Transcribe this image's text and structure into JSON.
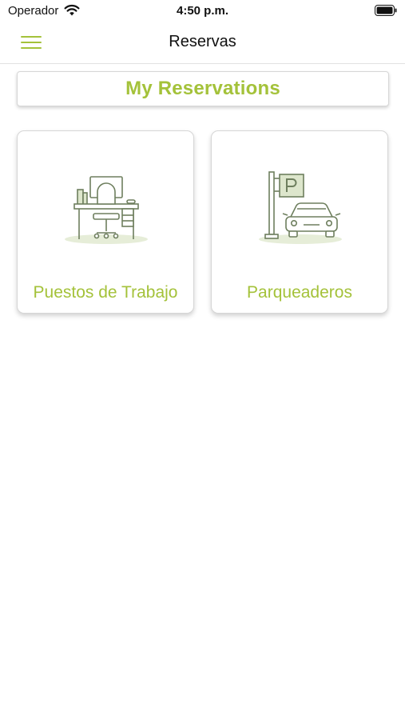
{
  "status_bar": {
    "carrier": "Operador",
    "time": "4:50 p.m."
  },
  "nav": {
    "title": "Reservas",
    "menu_icon": "hamburger-menu-icon"
  },
  "my_reservations": {
    "label": "My Reservations"
  },
  "cards": [
    {
      "label": "Puestos de Trabajo",
      "icon": "workstation-desk-icon"
    },
    {
      "label": "Parqueaderos",
      "icon": "parking-car-icon"
    }
  ],
  "colors": {
    "accent": "#a4c23a",
    "icon_stroke": "#6e7f5e",
    "icon_shadow": "#e6edd8"
  }
}
